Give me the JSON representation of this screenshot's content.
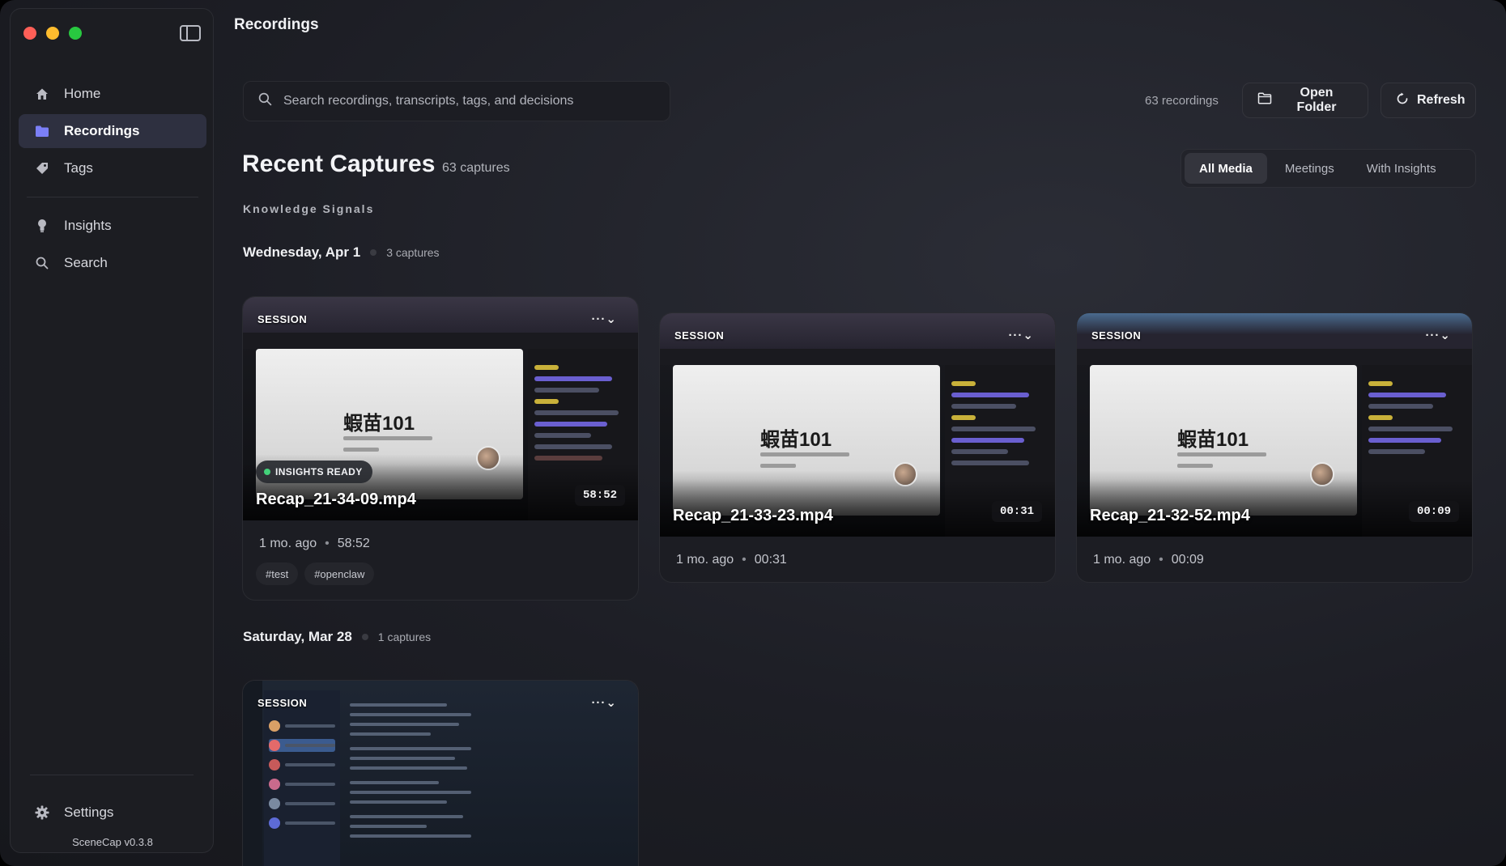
{
  "window": {
    "title": "Recordings"
  },
  "sidebar": {
    "items": [
      {
        "label": "Home",
        "icon": "home-icon",
        "active": false
      },
      {
        "label": "Recordings",
        "icon": "folder-icon",
        "active": true
      },
      {
        "label": "Tags",
        "icon": "tag-icon",
        "active": false
      },
      {
        "label": "Insights",
        "icon": "lightbulb-icon",
        "active": false
      },
      {
        "label": "Search",
        "icon": "search-icon",
        "active": false
      }
    ],
    "settings_label": "Settings",
    "version": "SceneCap v0.3.8"
  },
  "toolbar": {
    "search_placeholder": "Search recordings, transcripts, tags, and decisions",
    "recordings_count": "63 recordings",
    "open_folder_label": "Open Folder",
    "refresh_label": "Refresh"
  },
  "header": {
    "title": "Recent Captures",
    "subtitle": "63 captures",
    "filters": [
      {
        "label": "All Media",
        "active": true
      },
      {
        "label": "Meetings",
        "active": false
      },
      {
        "label": "With Insights",
        "active": false
      }
    ],
    "knowledge_label": "Knowledge Signals"
  },
  "groups": [
    {
      "date": "Wednesday, Apr 1",
      "count": "3 captures",
      "cards": [
        {
          "badge": "SESSION",
          "more": "···⌄",
          "insights": "INSIGHTS READY",
          "filename": "Recap_21-34-09.mp4",
          "duration": "58:52",
          "age": "1 mo. ago",
          "tags": [
            "#test",
            "#openclaw"
          ],
          "slide_text": "蝦苗101"
        },
        {
          "badge": "SESSION",
          "more": "···⌄",
          "filename": "Recap_21-33-23.mp4",
          "duration": "00:31",
          "age": "1 mo. ago",
          "slide_text": "蝦苗101"
        },
        {
          "badge": "SESSION",
          "more": "···⌄",
          "filename": "Recap_21-32-52.mp4",
          "duration": "00:09",
          "age": "1 mo. ago",
          "slide_text": "蝦苗101"
        }
      ]
    },
    {
      "date": "Saturday, Mar 28",
      "count": "1 captures",
      "cards": [
        {
          "badge": "SESSION",
          "more": "···⌄"
        }
      ]
    }
  ],
  "colors": {
    "accent": "#7b7ff7",
    "insights_dot": "#43d17a"
  }
}
